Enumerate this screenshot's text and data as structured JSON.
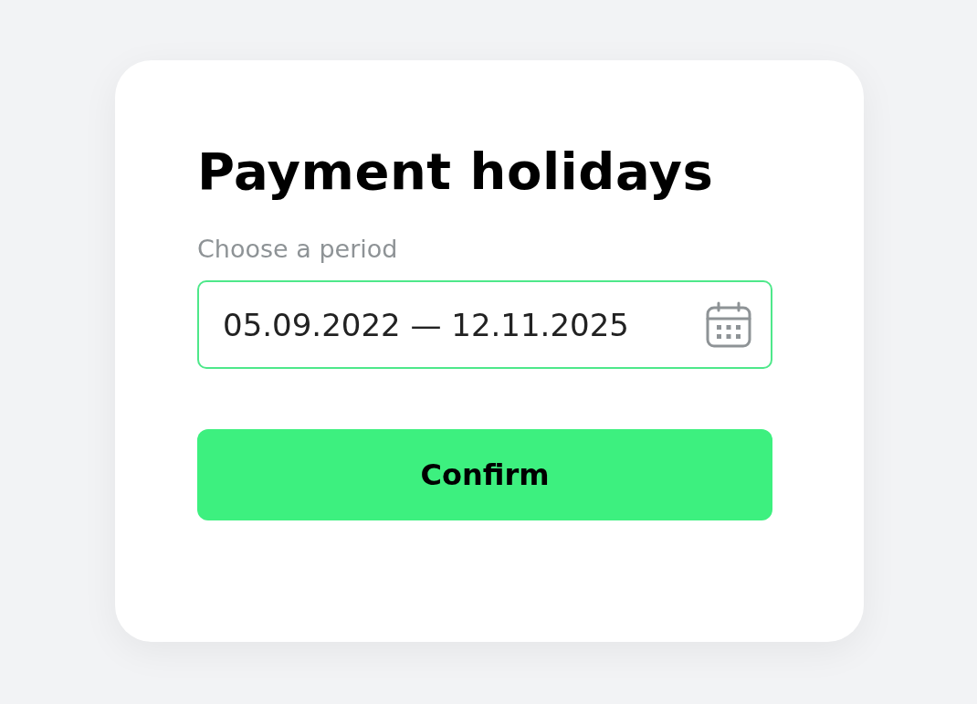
{
  "title": "Payment holidays",
  "period_field": {
    "label": "Choose a period",
    "value": "05.09.2022 — 12.11.2025",
    "focused": true
  },
  "buttons": [
    "Confirm"
  ]
}
